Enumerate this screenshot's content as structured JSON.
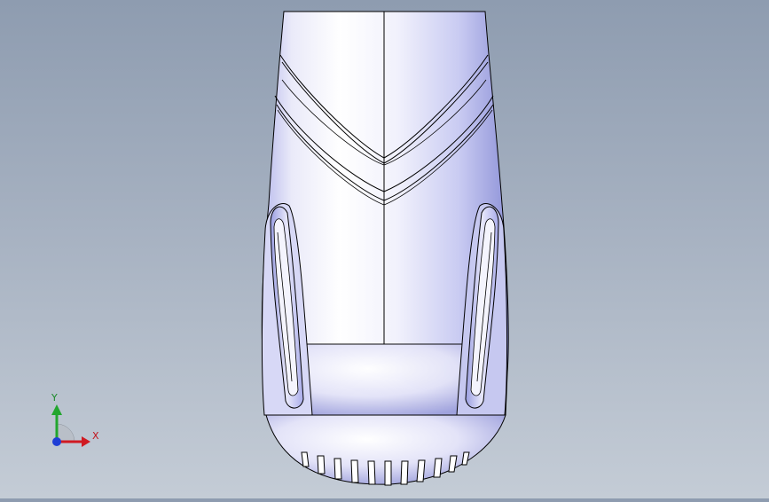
{
  "viewport": {
    "background_top": "#8e9cb0",
    "background_bottom": "#c4ccd6",
    "model_color": "#dcdcf6",
    "model_highlight": "#ffffff",
    "model_shadow": "#8f93d8"
  },
  "triad": {
    "x_label": "X",
    "y_label": "Y",
    "x_color": "#d01a22",
    "y_color": "#22a62e",
    "z_color": "#1f3fd6"
  }
}
